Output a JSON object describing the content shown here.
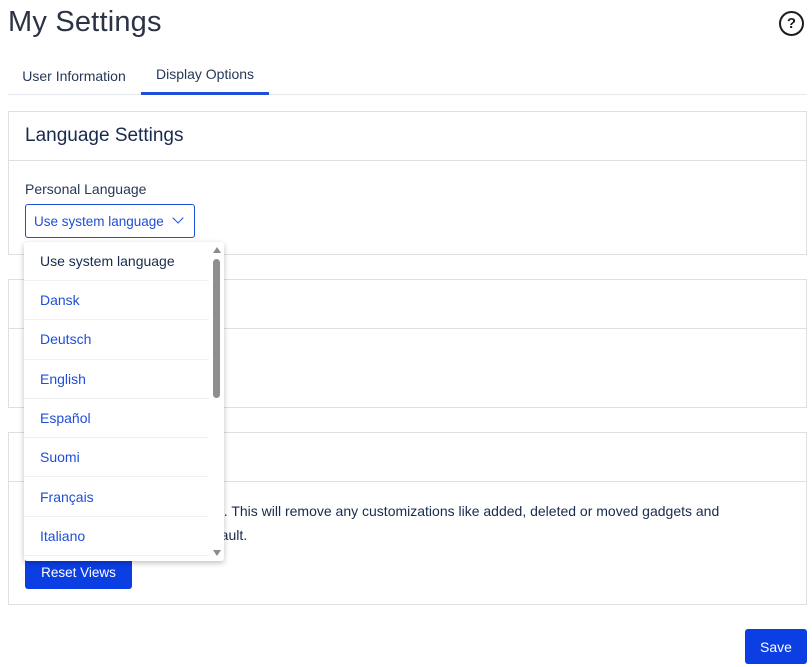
{
  "page": {
    "title": "My Settings"
  },
  "header": {
    "help_icon": "?"
  },
  "tabs": [
    {
      "label": "User Information",
      "active": false
    },
    {
      "label": "Display Options",
      "active": true
    }
  ],
  "language_settings": {
    "heading": "Language Settings",
    "field_label": "Personal Language",
    "selected_value": "Use system language"
  },
  "dropdown": {
    "options": [
      "Use system language",
      "Dansk",
      "Deutsch",
      "English",
      "Español",
      "Suomi",
      "Français",
      "Italiano"
    ]
  },
  "reset_views": {
    "text_line1": "ult. This will remove any customizations like added, deleted or moved gadgets and",
    "text_line2": "efault.",
    "button_label": "Reset Views"
  },
  "footer": {
    "save_label": "Save"
  },
  "colors": {
    "accent": "#1f4ed8",
    "button": "#0b3ee3",
    "text": "#172b4d",
    "border": "#dcdfe4"
  }
}
